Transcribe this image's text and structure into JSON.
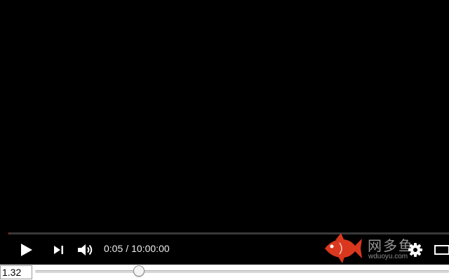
{
  "player": {
    "current_time": "0:05",
    "time_separator": "/",
    "duration": "10:00:00",
    "progress_fraction": 0.0001,
    "controls": {
      "play_icon": "play-icon",
      "next_icon": "next-icon",
      "volume_icon": "volume-icon",
      "settings_icon": "gear-icon",
      "theater_icon": "theater-mode-icon"
    }
  },
  "watermark": {
    "title": "网多鱼",
    "subtitle": "wduoyu.com",
    "icon": "fish-logo-icon",
    "color": "#d9381e"
  },
  "speed": {
    "value": "1.32",
    "slider_fraction": 0.25
  },
  "colors": {
    "background": "#000000",
    "progress": "#cc181e",
    "controls": "#ffffff"
  }
}
